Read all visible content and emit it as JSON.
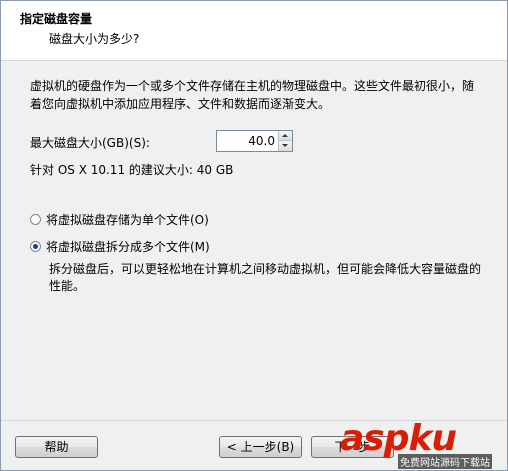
{
  "header": {
    "title": "指定磁盘容量",
    "subtitle": "磁盘大小为多少?"
  },
  "description": "虚拟机的硬盘作为一个或多个文件存储在主机的物理磁盘中。这些文件最初很小，随着您向虚拟机中添加应用程序、文件和数据而逐渐变大。",
  "disk_size": {
    "label": "最大磁盘大小(GB)(S):",
    "value": "40.0",
    "recommended": "针对 OS X 10.11 的建议大小: 40 GB"
  },
  "options": [
    {
      "label": "将虚拟磁盘存储为单个文件(O)",
      "checked": false
    },
    {
      "label": "将虚拟磁盘拆分成多个文件(M)",
      "checked": true
    }
  ],
  "note": "拆分磁盘后，可以更轻松地在计算机之间移动虚拟机，但可能会降低大容量磁盘的性能。",
  "buttons": {
    "help": "帮助",
    "back": "< 上一步(B)",
    "next": "下一步"
  },
  "watermark": {
    "brand": "aspku",
    "tagline": "免费网站源码下载站"
  }
}
